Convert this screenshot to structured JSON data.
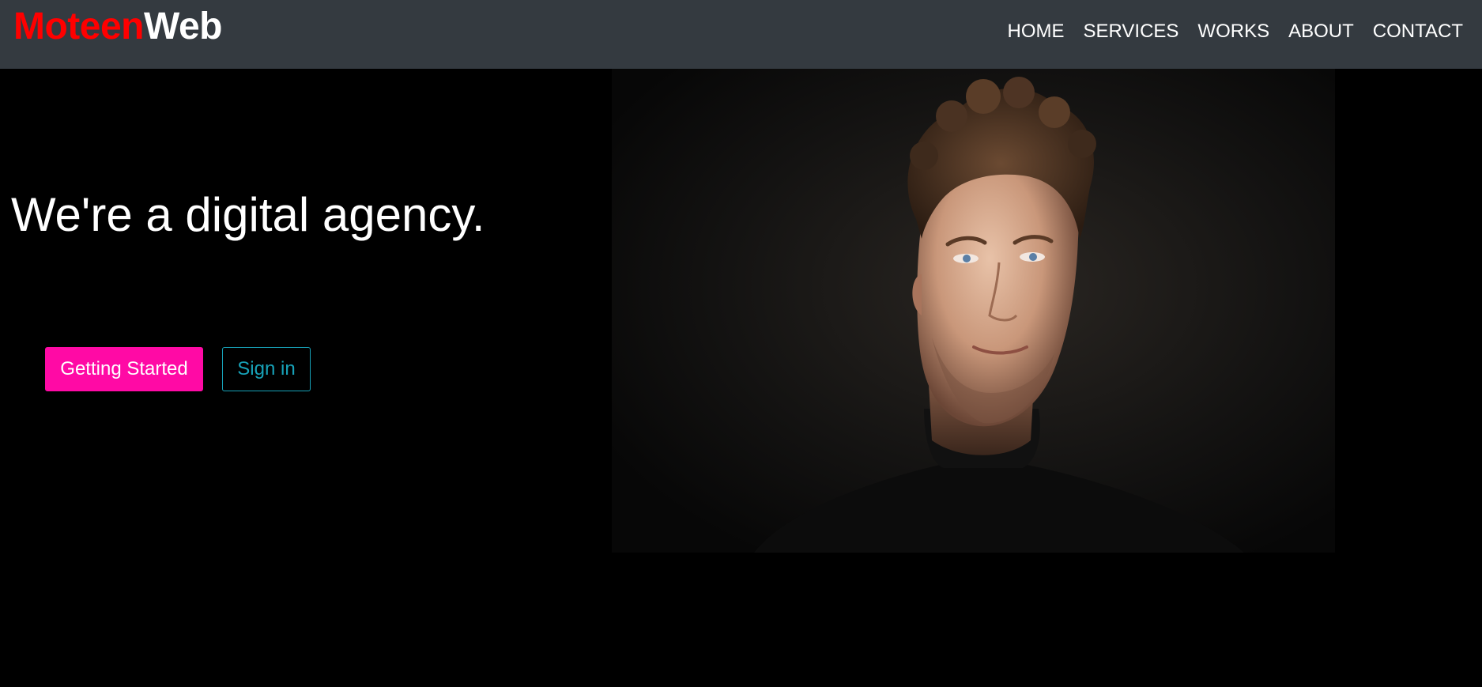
{
  "header": {
    "logo": {
      "part1": "Moteen",
      "part2": "Web"
    },
    "nav": [
      {
        "label": "HOME"
      },
      {
        "label": "SERVICES"
      },
      {
        "label": "WORKS"
      },
      {
        "label": "ABOUT"
      },
      {
        "label": "CONTACT"
      }
    ]
  },
  "hero": {
    "title": "We're a digital agency.",
    "primary_button": "Getting Started",
    "secondary_button": "Sign in"
  },
  "colors": {
    "navbar_bg": "#343a40",
    "page_bg": "#000000",
    "logo_accent": "#ff0000",
    "primary_button": "#ff0aa5",
    "outline_button": "#17a2b8"
  }
}
